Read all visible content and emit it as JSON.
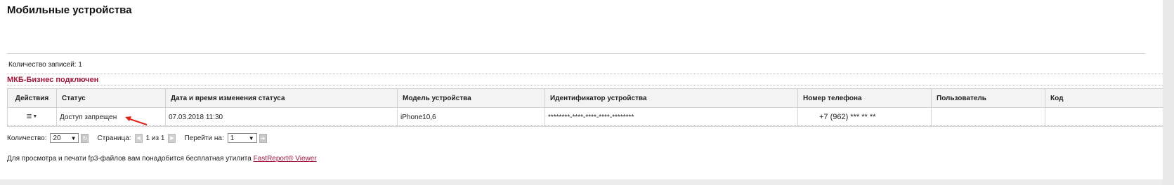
{
  "page": {
    "title": "Мобильные устройства"
  },
  "summary": {
    "count_label": "Количество записей: 1"
  },
  "status_heading": "МКБ-Бизнес подключен",
  "table": {
    "headers": [
      "Действия",
      "Статус",
      "Дата и время изменения статуса",
      "Модель устройства",
      "Идентификатор устройства",
      "Номер телефона",
      "Пользователь",
      "Код"
    ],
    "rows": [
      {
        "status": "Доступ запрещен",
        "changed_at": "07.03.2018 11:30",
        "model": "iPhone10,6",
        "device_id": "********-****-****-****-********",
        "phone": "+7 (962) *** ** **",
        "user": "",
        "code": ""
      }
    ]
  },
  "pager": {
    "quantity_label": "Количество:",
    "quantity_value": "20",
    "page_label": "Страница:",
    "page_info": "1 из 1",
    "goto_label": "Перейти на:",
    "goto_value": "1"
  },
  "footer": {
    "note": "Для просмотра и печати fp3-файлов вам понадобится бесплатная утилита ",
    "link": "FastReport® Viewer"
  },
  "colors": {
    "accent": "#a0173a",
    "annotation_arrow": "#e0241b"
  },
  "icons": {
    "actions": "hamburger-menu-icon",
    "refresh": "refresh-icon",
    "prev": "chevron-left-icon",
    "next": "chevron-right-icon",
    "go": "arrow-right-icon"
  }
}
